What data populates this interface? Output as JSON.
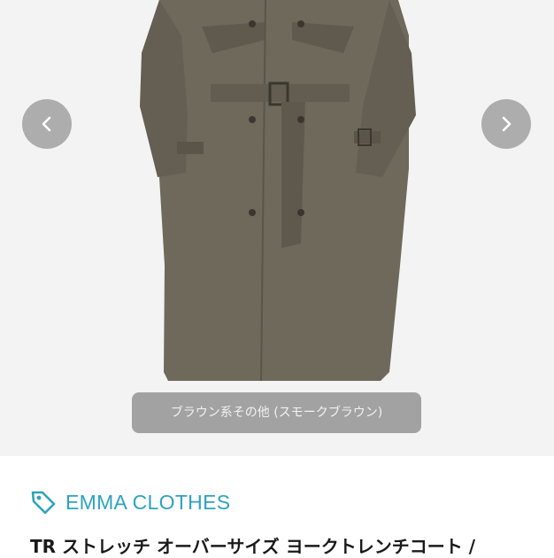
{
  "gallery": {
    "caption": "ブラウン系その他 (スモークブラウン)",
    "prev_icon": "chevron-left-icon",
    "next_icon": "chevron-right-icon"
  },
  "brand": {
    "icon": "tag-icon",
    "name": "EMMA CLOTHES",
    "color": "#2ea3bd"
  },
  "product": {
    "title": "TR ストレッチ オーバーサイズ ヨークトレンチコート /"
  }
}
